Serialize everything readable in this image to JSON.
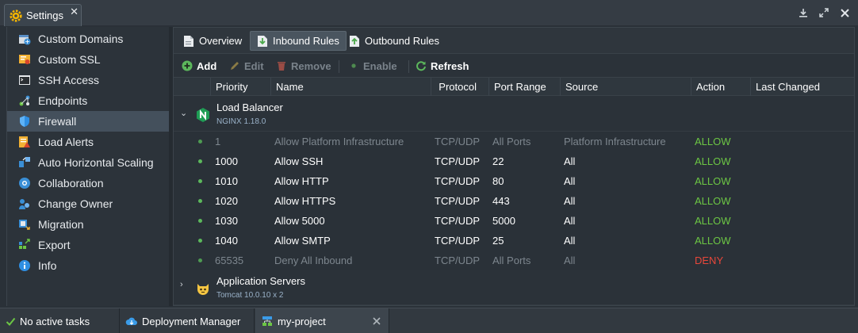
{
  "window": {
    "title": "Settings"
  },
  "sidebar": {
    "items": [
      {
        "label": "Custom Domains",
        "icon": "custom-domains-icon"
      },
      {
        "label": "Custom SSL",
        "icon": "custom-ssl-icon"
      },
      {
        "label": "SSH Access",
        "icon": "ssh-access-icon"
      },
      {
        "label": "Endpoints",
        "icon": "endpoints-icon"
      },
      {
        "label": "Firewall",
        "icon": "firewall-icon",
        "active": true
      },
      {
        "label": "Load Alerts",
        "icon": "load-alerts-icon"
      },
      {
        "label": "Auto Horizontal Scaling",
        "icon": "auto-scaling-icon"
      },
      {
        "label": "Collaboration",
        "icon": "collaboration-icon"
      },
      {
        "label": "Change Owner",
        "icon": "change-owner-icon"
      },
      {
        "label": "Migration",
        "icon": "migration-icon"
      },
      {
        "label": "Export",
        "icon": "export-icon"
      },
      {
        "label": "Info",
        "icon": "info-icon"
      }
    ]
  },
  "tabs": [
    {
      "label": "Overview",
      "icon": "document-icon"
    },
    {
      "label": "Inbound Rules",
      "icon": "inbound-icon",
      "active": true
    },
    {
      "label": "Outbound Rules",
      "icon": "outbound-icon"
    }
  ],
  "toolbar": {
    "add": "Add",
    "edit": "Edit",
    "remove": "Remove",
    "enable": "Enable",
    "refresh": "Refresh"
  },
  "columns": {
    "priority": "Priority",
    "name": "Name",
    "protocol": "Protocol",
    "port_range": "Port Range",
    "source": "Source",
    "action": "Action",
    "last_changed": "Last Changed"
  },
  "groups": [
    {
      "name": "Load Balancer",
      "sub": "NGINX 1.18.0",
      "expanded": true,
      "rules": [
        {
          "priority": "1",
          "name": "Allow Platform Infrastructure",
          "protocol": "TCP/UDP",
          "port_range": "All Ports",
          "source": "Platform Infrastructure",
          "action": "ALLOW",
          "dim": true
        },
        {
          "priority": "1000",
          "name": "Allow SSH",
          "protocol": "TCP/UDP",
          "port_range": "22",
          "source": "All",
          "action": "ALLOW"
        },
        {
          "priority": "1010",
          "name": "Allow HTTP",
          "protocol": "TCP/UDP",
          "port_range": "80",
          "source": "All",
          "action": "ALLOW"
        },
        {
          "priority": "1020",
          "name": "Allow HTTPS",
          "protocol": "TCP/UDP",
          "port_range": "443",
          "source": "All",
          "action": "ALLOW"
        },
        {
          "priority": "1030",
          "name": "Allow 5000",
          "protocol": "TCP/UDP",
          "port_range": "5000",
          "source": "All",
          "action": "ALLOW"
        },
        {
          "priority": "1040",
          "name": "Allow SMTP",
          "protocol": "TCP/UDP",
          "port_range": "25",
          "source": "All",
          "action": "ALLOW"
        },
        {
          "priority": "65535",
          "name": "Deny All Inbound",
          "protocol": "TCP/UDP",
          "port_range": "All Ports",
          "source": "All",
          "action": "DENY",
          "dim": true
        }
      ]
    },
    {
      "name": "Application Servers",
      "sub": "Tomcat 10.0.10 x 2",
      "expanded": false,
      "rules": []
    }
  ],
  "statusbar": {
    "tasks": "No active tasks",
    "deployment_manager": "Deployment Manager",
    "project": "my-project"
  },
  "colors": {
    "allow": "#6cc644",
    "deny": "#e8473a",
    "accent": "#44505c"
  }
}
